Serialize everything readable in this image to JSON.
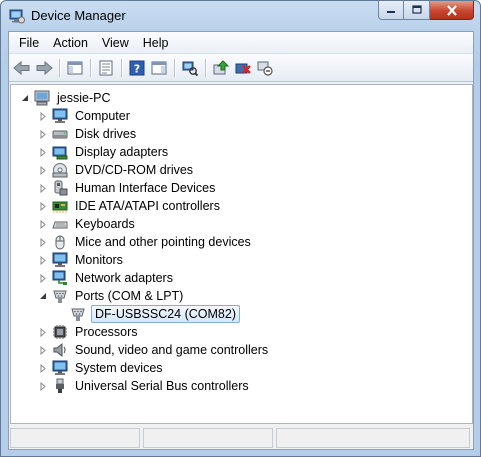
{
  "window": {
    "title": "Device Manager",
    "icon": "device-manager-icon",
    "caption_buttons": [
      "minimize",
      "maximize",
      "close"
    ]
  },
  "menu": {
    "items": [
      "File",
      "Action",
      "View",
      "Help"
    ]
  },
  "toolbar": {
    "buttons": [
      "back-arrow-icon",
      "forward-arrow-icon",
      "show-hide-tree-icon",
      "properties-icon",
      "help-icon",
      "show-action-pane-icon",
      "scan-hardware-icon",
      "update-driver-icon",
      "uninstall-device-icon",
      "disable-device-icon"
    ]
  },
  "tree": {
    "root": {
      "label": "jessie-PC",
      "icon": "computer-icon",
      "expanded": true
    },
    "categories": [
      {
        "label": "Computer",
        "icon": "monitor-icon",
        "expanded": false
      },
      {
        "label": "Disk drives",
        "icon": "disk-drive-icon",
        "expanded": false
      },
      {
        "label": "Display adapters",
        "icon": "display-adapter-icon",
        "expanded": false
      },
      {
        "label": "DVD/CD-ROM drives",
        "icon": "optical-drive-icon",
        "expanded": false
      },
      {
        "label": "Human Interface Devices",
        "icon": "hid-icon",
        "expanded": false
      },
      {
        "label": "IDE ATA/ATAPI controllers",
        "icon": "ide-controller-icon",
        "expanded": false
      },
      {
        "label": "Keyboards",
        "icon": "keyboard-icon",
        "expanded": false
      },
      {
        "label": "Mice and other pointing devices",
        "icon": "mouse-icon",
        "expanded": false
      },
      {
        "label": "Monitors",
        "icon": "monitor-icon",
        "expanded": false
      },
      {
        "label": "Network adapters",
        "icon": "network-adapter-icon",
        "expanded": false
      },
      {
        "label": "Ports (COM & LPT)",
        "icon": "port-icon",
        "expanded": true,
        "children": [
          {
            "label": "DF-USBSSC24 (COM82)",
            "icon": "port-icon",
            "selected": true
          }
        ]
      },
      {
        "label": "Processors",
        "icon": "processor-icon",
        "expanded": false
      },
      {
        "label": "Sound, video and game controllers",
        "icon": "speaker-icon",
        "expanded": false
      },
      {
        "label": "System devices",
        "icon": "monitor-icon",
        "expanded": false
      },
      {
        "label": "Universal Serial Bus controllers",
        "icon": "usb-icon",
        "expanded": false
      }
    ]
  },
  "colors": {
    "title_bar": "#bcd3ec",
    "close_button": "#c9452f",
    "selection_fill": "#d6e8fc",
    "selection_border": "#84acdd"
  }
}
